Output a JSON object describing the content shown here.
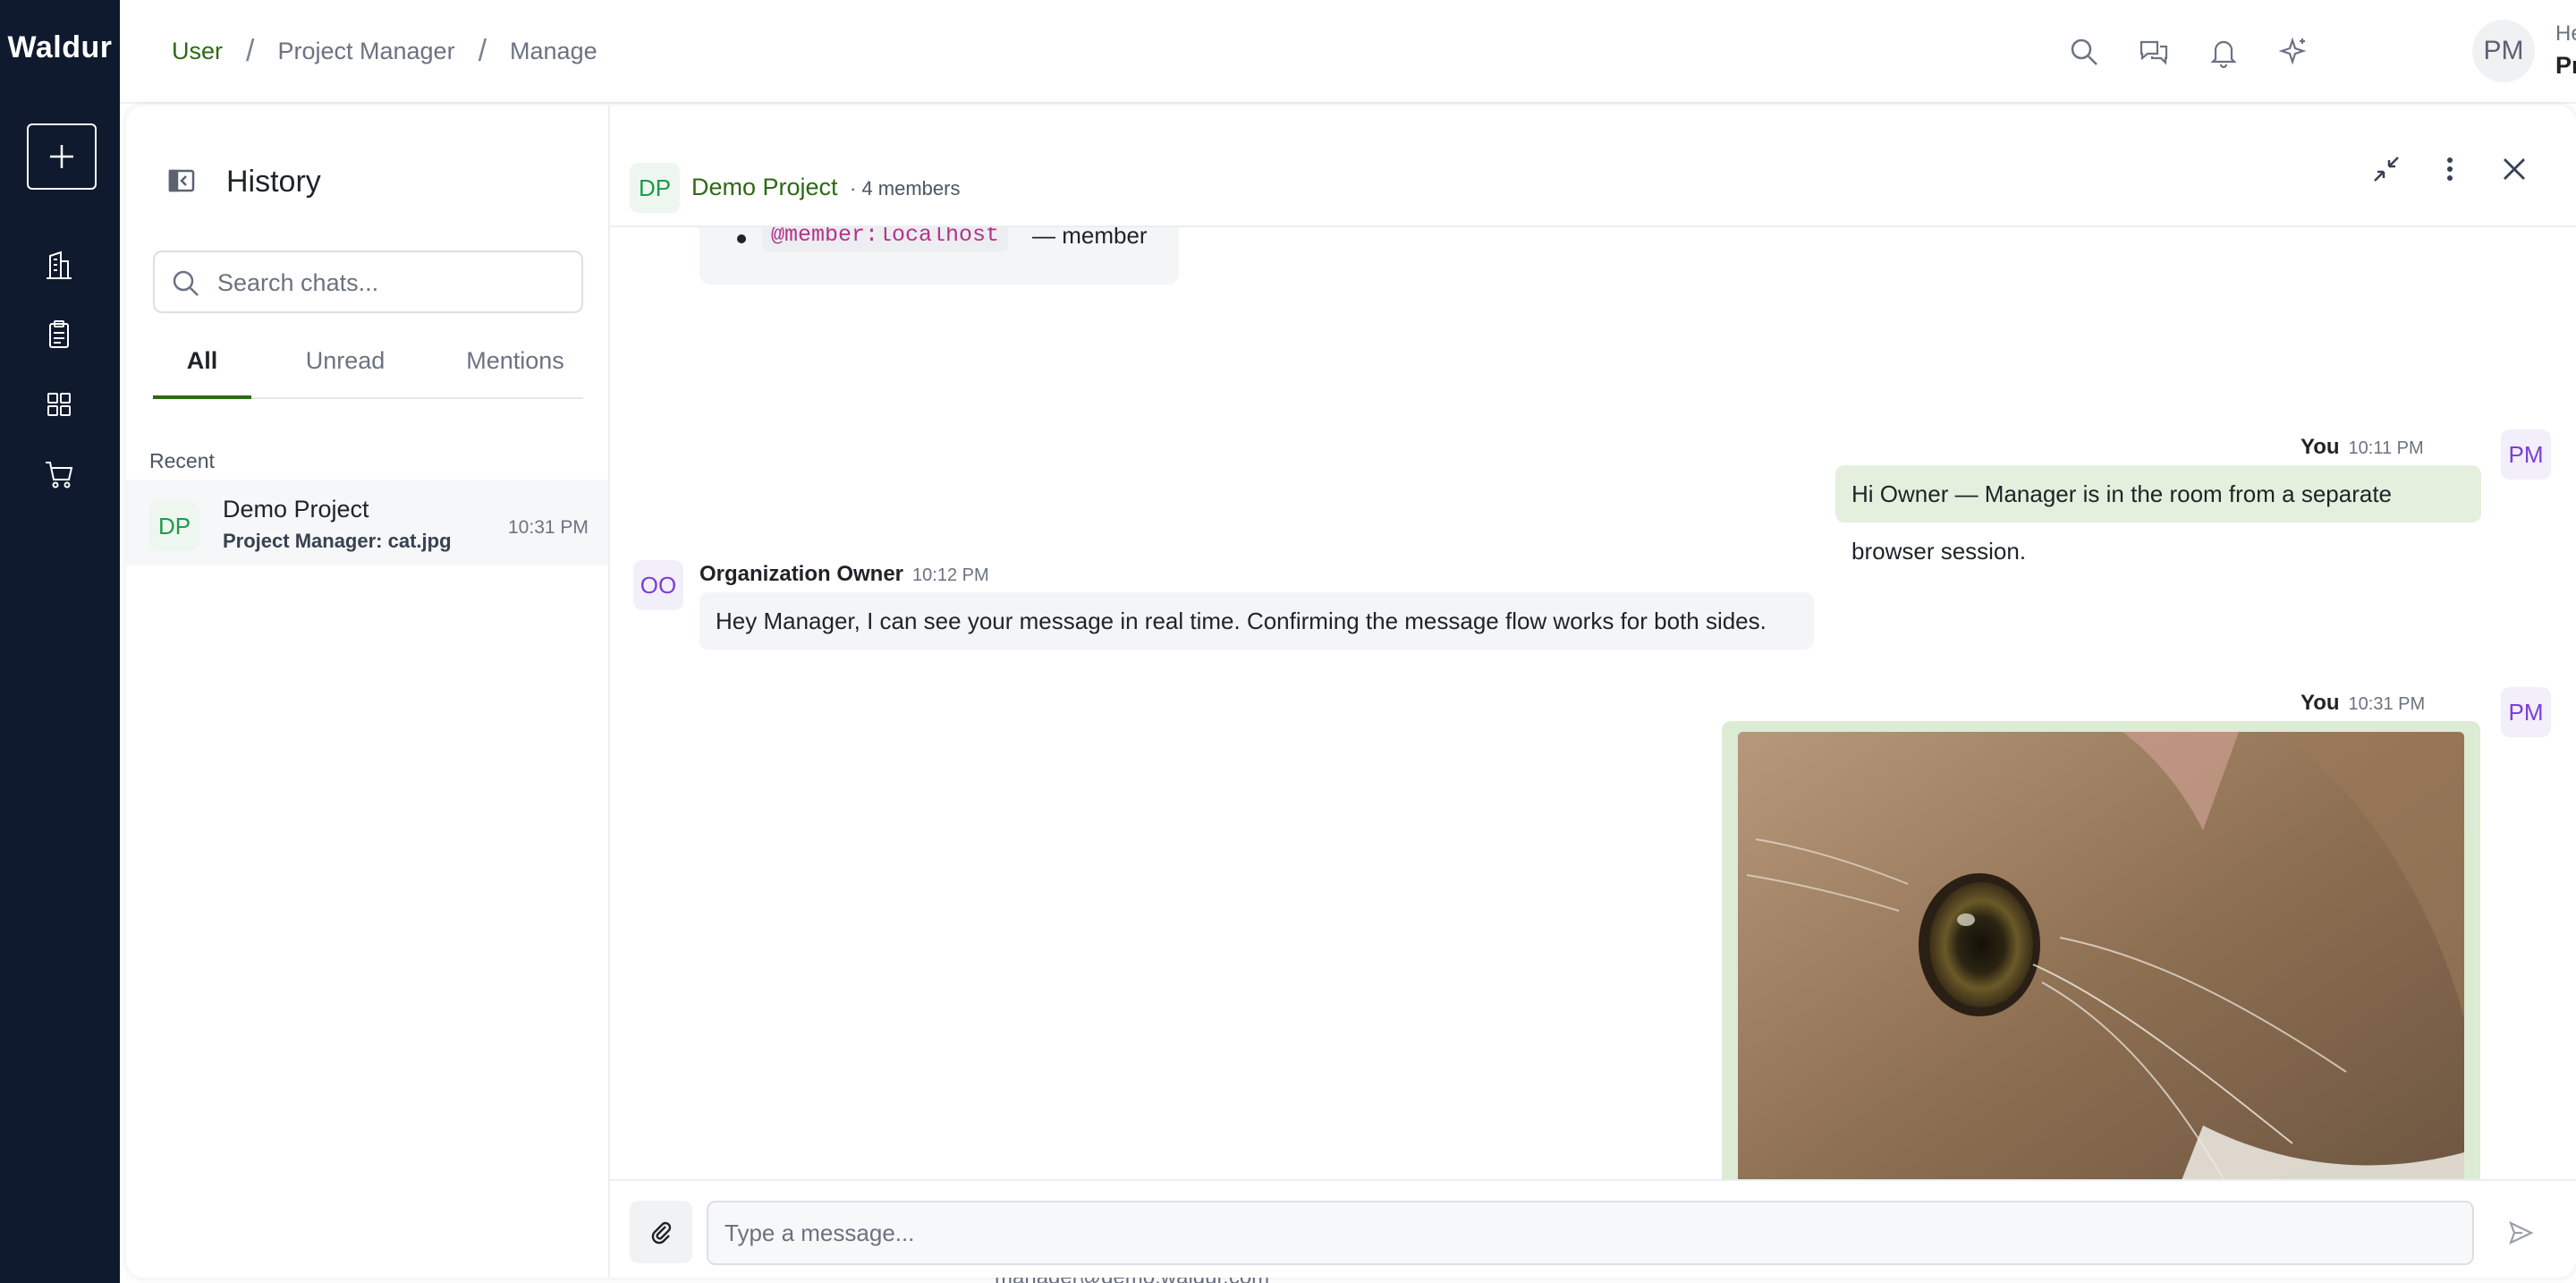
{
  "app": {
    "brand": "Waldur"
  },
  "breadcrumb": {
    "items": [
      "User",
      "Project Manager",
      "Manage"
    ]
  },
  "topbar": {
    "avatar_initials": "PM",
    "greeting": "Hello",
    "user_name": "Project",
    "icons": [
      "search-icon",
      "chat-icon",
      "bell-icon",
      "sparkle-icon"
    ]
  },
  "sidebar": {
    "icons": [
      "plus-icon",
      "building-icon",
      "clipboard-icon",
      "grid-icon",
      "cart-icon"
    ]
  },
  "history": {
    "title": "History",
    "search_placeholder": "Search chats...",
    "tabs": [
      "All",
      "Unread",
      "Mentions"
    ],
    "active_tab": "All",
    "recent_label": "Recent",
    "chats": [
      {
        "initials": "DP",
        "name": "Demo Project",
        "preview": "Project Manager: cat.jpg",
        "time": "10:31 PM"
      }
    ]
  },
  "room": {
    "initials": "DP",
    "name": "Demo Project",
    "members": "· 4 members",
    "prev_message": {
      "mention": "@member:localhost",
      "role_text": "— member"
    },
    "messages": [
      {
        "sender": "You",
        "time": "10:11 PM",
        "initials": "PM",
        "text": "Hi Owner — Manager is in the room from a separate browser session."
      },
      {
        "sender": "Organization Owner",
        "time": "10:12 PM",
        "initials": "OO",
        "text": "Hey Manager, I can see your message in real time. Confirming the message flow works for both sides."
      },
      {
        "sender": "You",
        "time": "10:31 PM",
        "initials": "PM",
        "attachment": "cat-photo"
      }
    ],
    "composer_placeholder": "Type a message..."
  },
  "background": {
    "partial_text": "manager@demo.waldur.com"
  },
  "colors": {
    "rail": "#0f1a2e",
    "accent": "#2d6a12",
    "outgoing_bubble": "#e4f0dd"
  }
}
